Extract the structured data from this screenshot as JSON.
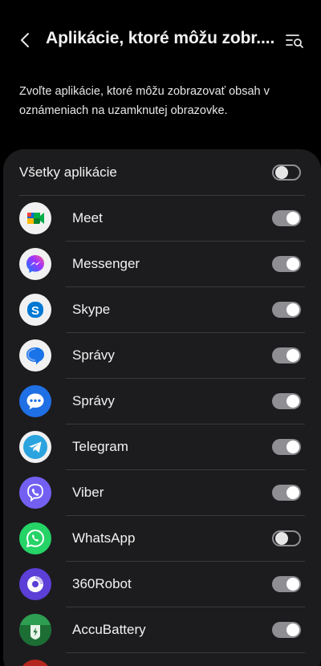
{
  "header": {
    "title": "Aplikácie, ktoré môžu zobr...."
  },
  "description": "Zvoľte aplikácie, ktoré môžu zobrazovať obsah v oznámeniach na uzamknutej obrazovke.",
  "all_apps": {
    "label": "Všetky aplikácie",
    "enabled": false
  },
  "apps": [
    {
      "name": "Meet",
      "icon": "google-meet-icon",
      "enabled": true
    },
    {
      "name": "Messenger",
      "icon": "messenger-icon",
      "enabled": true
    },
    {
      "name": "Skype",
      "icon": "skype-icon",
      "enabled": true
    },
    {
      "name": "Správy",
      "icon": "google-messages-icon",
      "enabled": true
    },
    {
      "name": "Správy",
      "icon": "samsung-messages-icon",
      "enabled": true
    },
    {
      "name": "Telegram",
      "icon": "telegram-icon",
      "enabled": true
    },
    {
      "name": "Viber",
      "icon": "viber-icon",
      "enabled": true
    },
    {
      "name": "WhatsApp",
      "icon": "whatsapp-icon",
      "enabled": false
    },
    {
      "name": "360Robot",
      "icon": "360robot-icon",
      "enabled": true
    },
    {
      "name": "AccuBattery",
      "icon": "accubattery-icon",
      "enabled": true
    }
  ],
  "colors": {
    "background": "#000000",
    "card": "#1c1c1e",
    "toggle_on": "#8e8e93",
    "separator": "#3a3a3c"
  }
}
